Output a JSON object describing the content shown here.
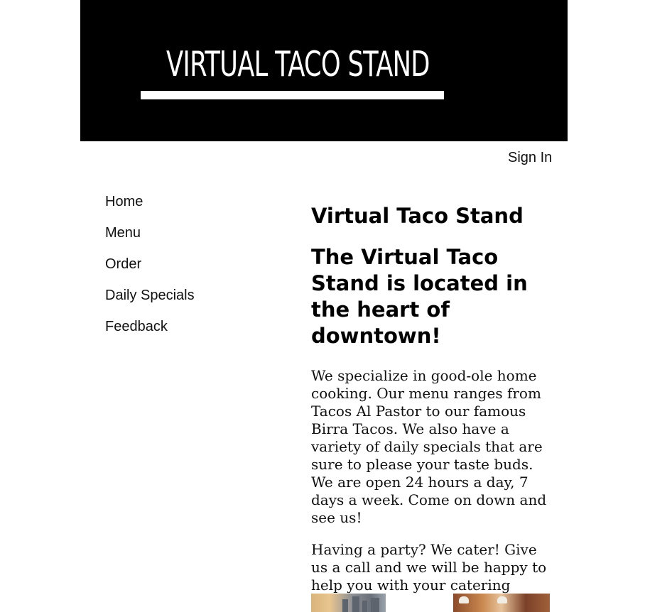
{
  "header": {
    "logo_text": "VIRTUAL TACO STAND",
    "sign_in": "Sign In"
  },
  "nav": {
    "items": [
      {
        "label": "Home"
      },
      {
        "label": "Menu"
      },
      {
        "label": "Order"
      },
      {
        "label": "Daily Specials"
      },
      {
        "label": "Feedback"
      }
    ]
  },
  "main": {
    "title": "Virtual Taco Stand",
    "subtitle": "The Virtual Taco Stand is located in the heart of downtown!",
    "paragraph1": "We specialize in good-ole home cooking. Our menu ranges from Tacos Al Pastor to our famous Birra Tacos. We also have a variety of daily specials that are sure to please your taste buds. We are open 24 hours a day, 7 days a week. Come on down and see us!",
    "paragraph2": "Having a party? We cater! Give us a call and we will be happy to help you with your catering needs."
  },
  "colors": {
    "banner_bg": "#000000",
    "text": "#111111",
    "page_bg": "#ffffff"
  }
}
